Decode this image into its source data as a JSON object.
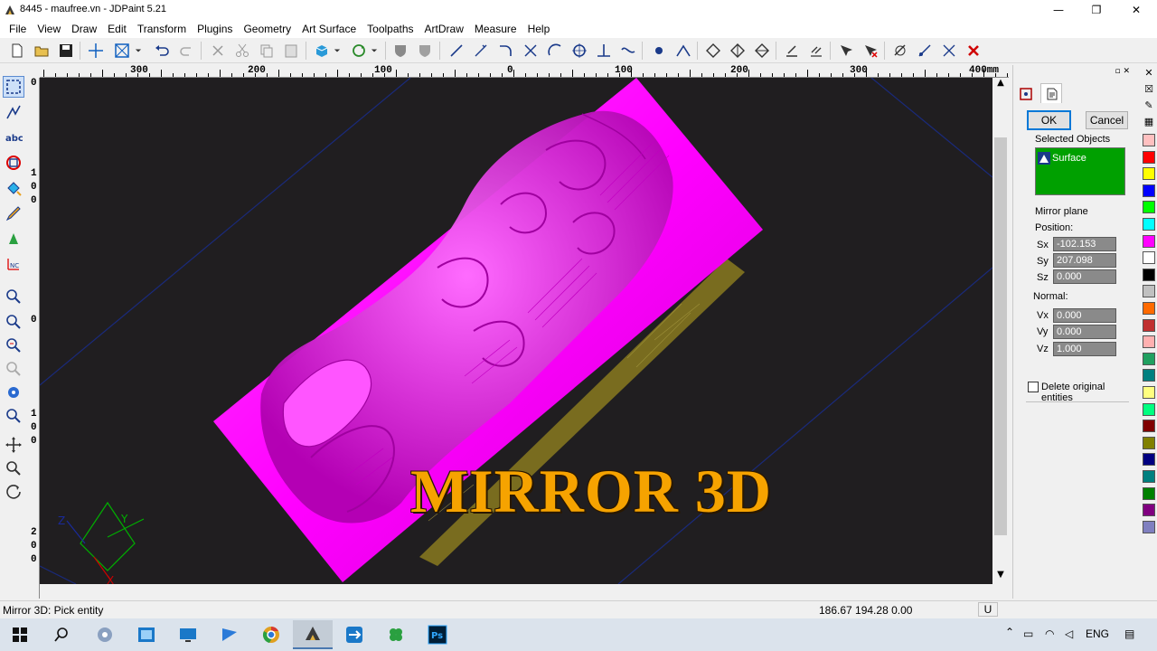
{
  "window": {
    "title": "8445 - maufree.vn - JDPaint 5.21",
    "minimize": "—",
    "maximize": "❐",
    "close": "✕"
  },
  "menu": [
    "File",
    "View",
    "Draw",
    "Edit",
    "Transform",
    "Plugins",
    "Geometry",
    "Art Surface",
    "Toolpaths",
    "ArtDraw",
    "Measure",
    "Help"
  ],
  "rulers": {
    "horizontal": [
      "300",
      "200",
      "100",
      "0",
      "100",
      "200",
      "300",
      "400mm"
    ],
    "vertical": [
      {
        "chars": [
          "0"
        ]
      },
      {
        "chars": [
          "1",
          "0",
          "0"
        ]
      },
      {
        "chars": [
          "0"
        ]
      },
      {
        "chars": [
          "1",
          "0",
          "0"
        ]
      },
      {
        "chars": [
          "2",
          "0",
          "0"
        ]
      }
    ]
  },
  "viewport": {
    "overlay_text": "MIRROR 3D",
    "axes": {
      "x": "X",
      "y": "Y",
      "z": "Z"
    },
    "colors": {
      "background": "#201e20",
      "surface": "#ff00ff",
      "grid_lines": "#1a2a7a",
      "overlay": "#f6a300"
    }
  },
  "panel": {
    "ok": "OK",
    "cancel": "Cancel",
    "selected_objects_label": "Selected Objects",
    "selected_item": "Surface",
    "selection_bg": "#00a000",
    "mirror_plane_label": "Mirror plane",
    "position_label": "Position:",
    "position": [
      {
        "label": "Sx",
        "value": "-102.153"
      },
      {
        "label": "Sy",
        "value": "207.098"
      },
      {
        "label": "Sz",
        "value": "0.000"
      }
    ],
    "normal_label": "Normal:",
    "normal": [
      {
        "label": "Vx",
        "value": "0.000"
      },
      {
        "label": "Vy",
        "value": "0.000"
      },
      {
        "label": "Vz",
        "value": "1.000"
      }
    ],
    "delete_original": "Delete original entities"
  },
  "palette": [
    "#ffc0c0",
    "#ff0000",
    "#ffff00",
    "#0000ff",
    "#00ff00",
    "#00ffff",
    "#ff00ff",
    "#ffffff",
    "#000000",
    "#c0c0c0",
    "#ff6a00",
    "#c03030",
    "#ffb0b0",
    "#20a060",
    "#008080",
    "#ffff80",
    "#00ff80",
    "#800000",
    "#808000",
    "#000080",
    "#008080",
    "#008000",
    "#800080",
    "#8080c0"
  ],
  "status": {
    "message": "Mirror 3D: Pick entity",
    "coords": "186.67 194.28 0.00",
    "unit": "U"
  },
  "taskbar": {
    "language": "ENG"
  }
}
